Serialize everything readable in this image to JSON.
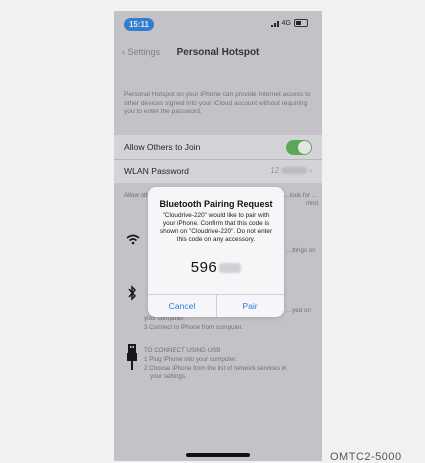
{
  "status": {
    "time": "15:11",
    "network": "4G"
  },
  "nav": {
    "back_label": "Settings",
    "title": "Personal Hotspot"
  },
  "description": "Personal Hotspot on your iPhone can provide Internet access to other devices signed into your iCloud account without requiring you to enter the password.",
  "settings": {
    "allow_label": "Allow Others to Join",
    "allow_on": true,
    "wlan_label": "WLAN Password",
    "wlan_value": "12"
  },
  "info_text": "Allow others… your shar… Personal… Center.",
  "info_right": "…look for …ntrol",
  "wifi_right": "…ttings on",
  "bt_right": "…yed on",
  "bt_steps": [
    "your computer.",
    "3 Connect to iPhone from computer."
  ],
  "usb": {
    "heading": "TO CONNECT USING USB",
    "steps": [
      "1 Plug iPhone into your computer.",
      "2 Choose iPhone from the list of network services in",
      "your settings."
    ]
  },
  "dialog": {
    "title": "Bluetooth Pairing Request",
    "message": "\"Cloudrive-220\" would like to pair with your iPhone. Confirm that this code is shown on \"Cloudrive-220\". Do not enter this code on any accessory.",
    "code": "596",
    "cancel_label": "Cancel",
    "pair_label": "Pair"
  },
  "caption": "OMTC2-5000",
  "icons": {
    "wifi": "wifi-icon",
    "bluetooth": "bluetooth-icon",
    "usb": "usb-icon"
  },
  "colors": {
    "accent": "#2f7ee0",
    "toggle_on": "#5fb95a",
    "time_pill": "#2f86e6"
  }
}
